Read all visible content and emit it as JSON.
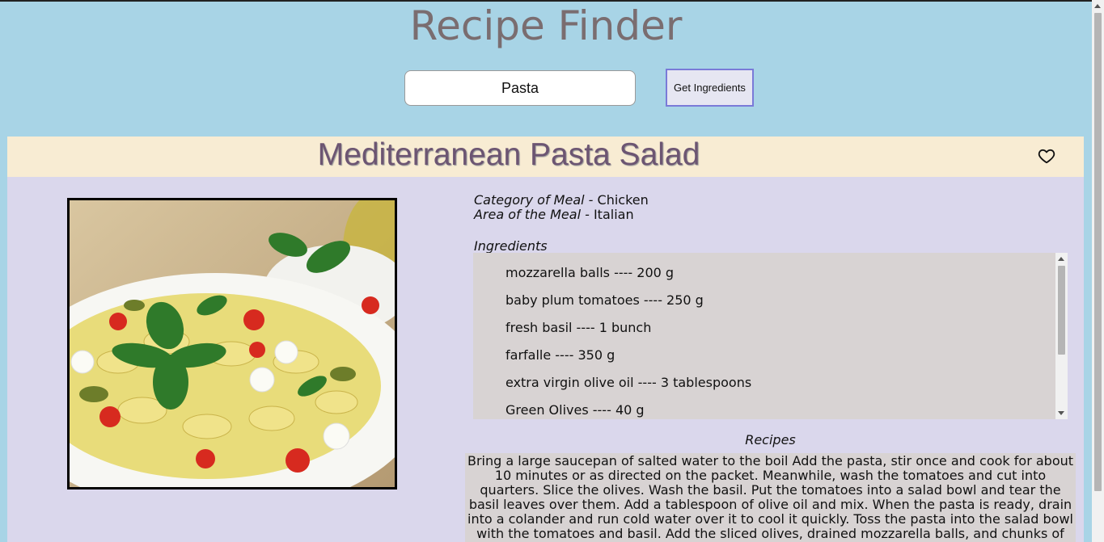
{
  "app": {
    "title": "Recipe Finder"
  },
  "search": {
    "value": "Pasta",
    "button_label": "Get Ingredients"
  },
  "meal": {
    "title": "Mediterranean Pasta Salad",
    "category_label": "Category of Meal - ",
    "category": "Chicken",
    "area_label": "Area of the Meal - ",
    "area": "Italian",
    "image_subject": "pasta-salad-photo",
    "ingredients_label": "Ingredients",
    "ingredients": [
      "mozzarella balls ---- 200 g",
      "baby plum tomatoes ---- 250 g",
      "fresh basil ---- 1 bunch",
      "farfalle ---- 350 g",
      "extra virgin olive oil ---- 3 tablespoons",
      "Green Olives ---- 40 g"
    ],
    "recipes_label": "Recipes",
    "recipe_text": "Bring a large saucepan of salted water to the boil Add the pasta, stir once and cook for about 10 minutes or as directed on the packet. Meanwhile, wash the tomatoes and cut into quarters. Slice the olives. Wash the basil. Put the tomatoes into a salad bowl and tear the basil leaves over them. Add a tablespoon of olive oil and mix. When the pasta is ready, drain into a colander and run cold water over it to cool it quickly. Toss the pasta into the salad bowl with the tomatoes and basil. Add the sliced olives, drained mozzarella balls, and chunks of tuna. Mix well and let the salad rest for at least half an hour to"
  },
  "icons": {
    "favorite": "heart-outline-icon"
  },
  "colors": {
    "page_background": "#a8d4e6",
    "title_text": "#7a6d70",
    "header_band": "#f8ecd3",
    "panel_background": "#dad7ec",
    "content_box": "#d8d3d3",
    "meal_title_text": "#6c5572",
    "button_border": "#7a7ad8"
  }
}
